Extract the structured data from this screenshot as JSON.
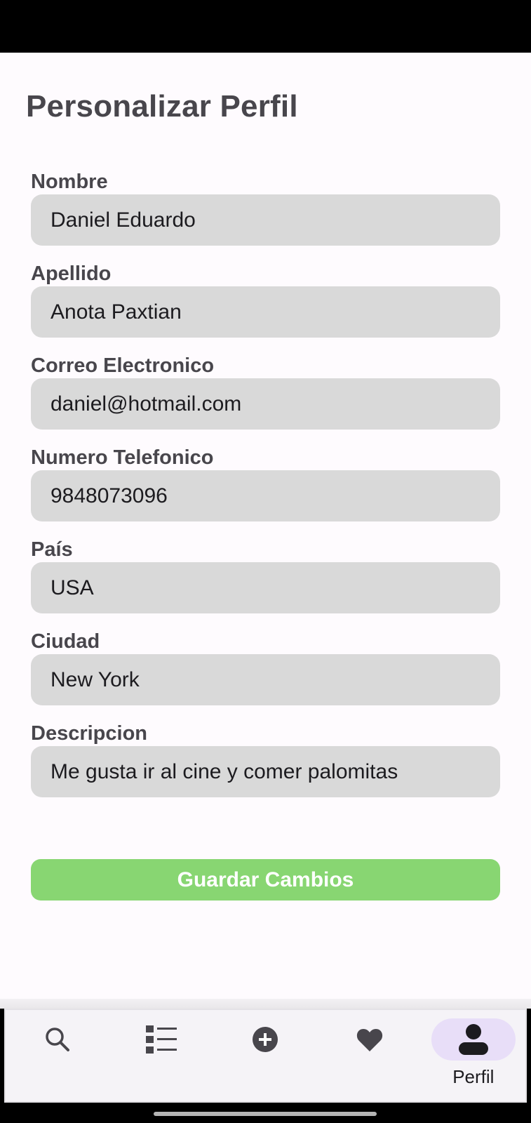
{
  "page": {
    "title": "Personalizar Perfil"
  },
  "form": {
    "fields": [
      {
        "label": "Nombre",
        "value": "Daniel Eduardo"
      },
      {
        "label": "Apellido",
        "value": "Anota Paxtian"
      },
      {
        "label": "Correo Electronico",
        "value": "daniel@hotmail.com"
      },
      {
        "label": "Numero Telefonico",
        "value": "9848073096"
      },
      {
        "label": "País",
        "value": "USA"
      },
      {
        "label": "Ciudad",
        "value": "New York"
      },
      {
        "label": "Descripcion",
        "value": "Me gusta ir al cine y comer palomitas"
      }
    ],
    "save_label": "Guardar Cambios"
  },
  "nav": {
    "items": [
      {
        "icon": "search-icon",
        "label": ""
      },
      {
        "icon": "list-icon",
        "label": ""
      },
      {
        "icon": "add-circle-icon",
        "label": ""
      },
      {
        "icon": "heart-icon",
        "label": ""
      },
      {
        "icon": "person-icon",
        "label": "Perfil",
        "active": true
      }
    ]
  },
  "colors": {
    "background": "#fefbfe",
    "input_bg": "#d9d9d9",
    "button_bg": "#88d672",
    "active_pill": "#e8def8",
    "text_dark": "#48464c"
  }
}
